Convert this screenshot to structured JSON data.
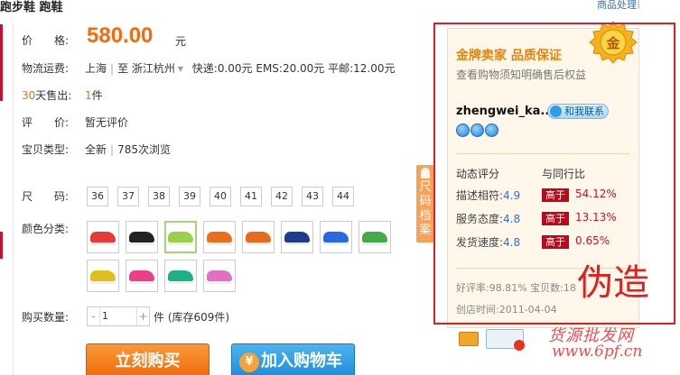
{
  "header": {
    "title": "跑步鞋 跑鞋",
    "top_link": "商品处理",
    "top_sep": "|"
  },
  "price": {
    "label": "价　　格:",
    "value": "580.00",
    "unit": "元"
  },
  "shipping": {
    "label": "物流运费:",
    "from": "上海",
    "to_prefix": "至",
    "to": "浙江杭州",
    "detail": "快递:0.00元 EMS:20.00元 平邮:12.00元"
  },
  "sold": {
    "label_days": "30",
    "label_rest": "天售出:",
    "count": "1",
    "unit": "件"
  },
  "review": {
    "label": "评　　价:",
    "value": "暂无评价"
  },
  "item_type": {
    "label": "宝贝类型:",
    "value": "全新",
    "views": "785次浏览"
  },
  "sizes": {
    "label": "尺　　码:",
    "options": [
      "36",
      "37",
      "38",
      "39",
      "40",
      "41",
      "42",
      "43",
      "44"
    ]
  },
  "colors": {
    "label": "颜色分类:",
    "swatches": [
      "#e83a3a",
      "#222222",
      "#9ad04a",
      "#e8701c",
      "#e86a1c",
      "#1d3b8f",
      "#2a6adf",
      "#45a84b",
      "#e0c01a",
      "#ec3f85",
      "#20b089",
      "#e070c0"
    ]
  },
  "quantity": {
    "label": "购买数量:",
    "value": "1",
    "minus": "-",
    "plus": "+",
    "stock": "件 (库存609件)"
  },
  "buttons": {
    "buy": "立刻购买",
    "cart": "加入购物车",
    "cart_icon": "¥"
  },
  "size_tab": {
    "label": "尺码档案"
  },
  "seller": {
    "title": "金牌卖家 品质保证",
    "subtitle": "查看购物须知明确售后权益",
    "medal": "金",
    "name": "zhengwei_ka...",
    "contact": "和我联系",
    "score_title": "动态评分",
    "compare_title": "与同行比",
    "scores": [
      {
        "label": "描述相符:",
        "value": "4.9",
        "badge": "高于",
        "pct": "54.12%"
      },
      {
        "label": "服务态度:",
        "value": "4.8",
        "badge": "高于",
        "pct": "13.13%"
      },
      {
        "label": "发货速度:",
        "value": "4.8",
        "badge": "高于",
        "pct": "0.65%"
      }
    ],
    "good_rate": "好评率:98.81% 宝贝数:18",
    "open_date": "创店时间:2011-04-04"
  },
  "annotation": {
    "fake_label": "伪造"
  },
  "watermark": {
    "line1": "货源批发网",
    "line2": "www.6pf.cn"
  }
}
